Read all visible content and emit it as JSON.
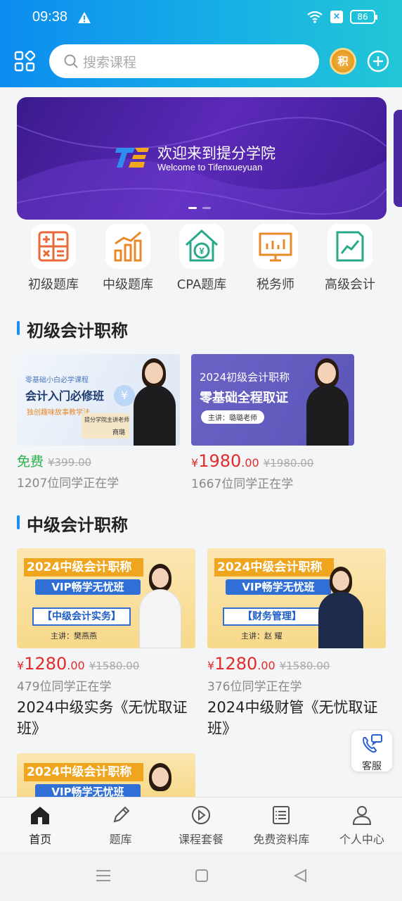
{
  "status": {
    "time": "09:38",
    "battery": "86"
  },
  "search": {
    "placeholder": "搜索课程",
    "points_badge": "积"
  },
  "banner": {
    "title_cn": "欢迎来到提分学院",
    "title_en": "Welcome to Tifenxueyuan"
  },
  "categories": [
    {
      "label": "初级题库",
      "icon": "calculator-icon"
    },
    {
      "label": "中级题库",
      "icon": "bar-chart-icon"
    },
    {
      "label": "CPA题库",
      "icon": "house-yen-icon"
    },
    {
      "label": "税务师",
      "icon": "presentation-board-icon"
    },
    {
      "label": "高级会计",
      "icon": "trend-document-icon"
    }
  ],
  "sections": {
    "junior": {
      "title": "初级会计职称",
      "courses": [
        {
          "thumb_small": "零基础小白必学课程",
          "thumb_title": "会计入门必修班",
          "thumb_sub": "独创趣味故事教学法",
          "thumb_teacher": "提分学院主讲老师",
          "thumb_teacher_name": "商璐",
          "price_free": "免费",
          "original_price": "¥399.00",
          "learners": "1207位同学正在学"
        },
        {
          "thumb_title": "2024初级会计职称",
          "thumb_sub": "零基础全程取证",
          "thumb_teacher": "主讲：璐璐老师",
          "price_int": "1980",
          "price_dec": ".00",
          "original_price": "¥1980.00",
          "learners": "1667位同学正在学"
        }
      ]
    },
    "intermediate": {
      "title": "中级会计职称",
      "courses": [
        {
          "ribbon": "2024中级会计职称",
          "vip": "VIP畅学无忧班",
          "subject": "【中级会计实务】",
          "teacher": "主讲：樊燕燕",
          "price_int": "1280",
          "price_dec": ".00",
          "original_price": "¥1580.00",
          "learners": "479位同学正在学",
          "title": "2024中级实务《无忧取证班》"
        },
        {
          "ribbon": "2024中级会计职称",
          "vip": "VIP畅学无忧班",
          "subject": "【财务管理】",
          "teacher": "主讲：赵 耀",
          "price_int": "1280",
          "price_dec": ".00",
          "original_price": "¥1580.00",
          "learners": "376位同学正在学",
          "title": "2024中级财管《无忧取证班》"
        },
        {
          "ribbon": "2024中级会计职称",
          "vip": "VIP畅学无忧班"
        }
      ]
    }
  },
  "service_label": "客服",
  "tabs": [
    {
      "label": "首页",
      "icon": "home-icon",
      "active": true
    },
    {
      "label": "题库",
      "icon": "pencil-icon"
    },
    {
      "label": "课程套餐",
      "icon": "play-circle-icon"
    },
    {
      "label": "免费资料库",
      "icon": "document-list-icon"
    },
    {
      "label": "个人中心",
      "icon": "user-icon"
    }
  ],
  "colors": {
    "header_start": "#0c8cf0",
    "header_end": "#22c7d6",
    "price_red": "#e22b2b",
    "free_green": "#2bb24c",
    "accent_blue": "#1b8ef0"
  }
}
